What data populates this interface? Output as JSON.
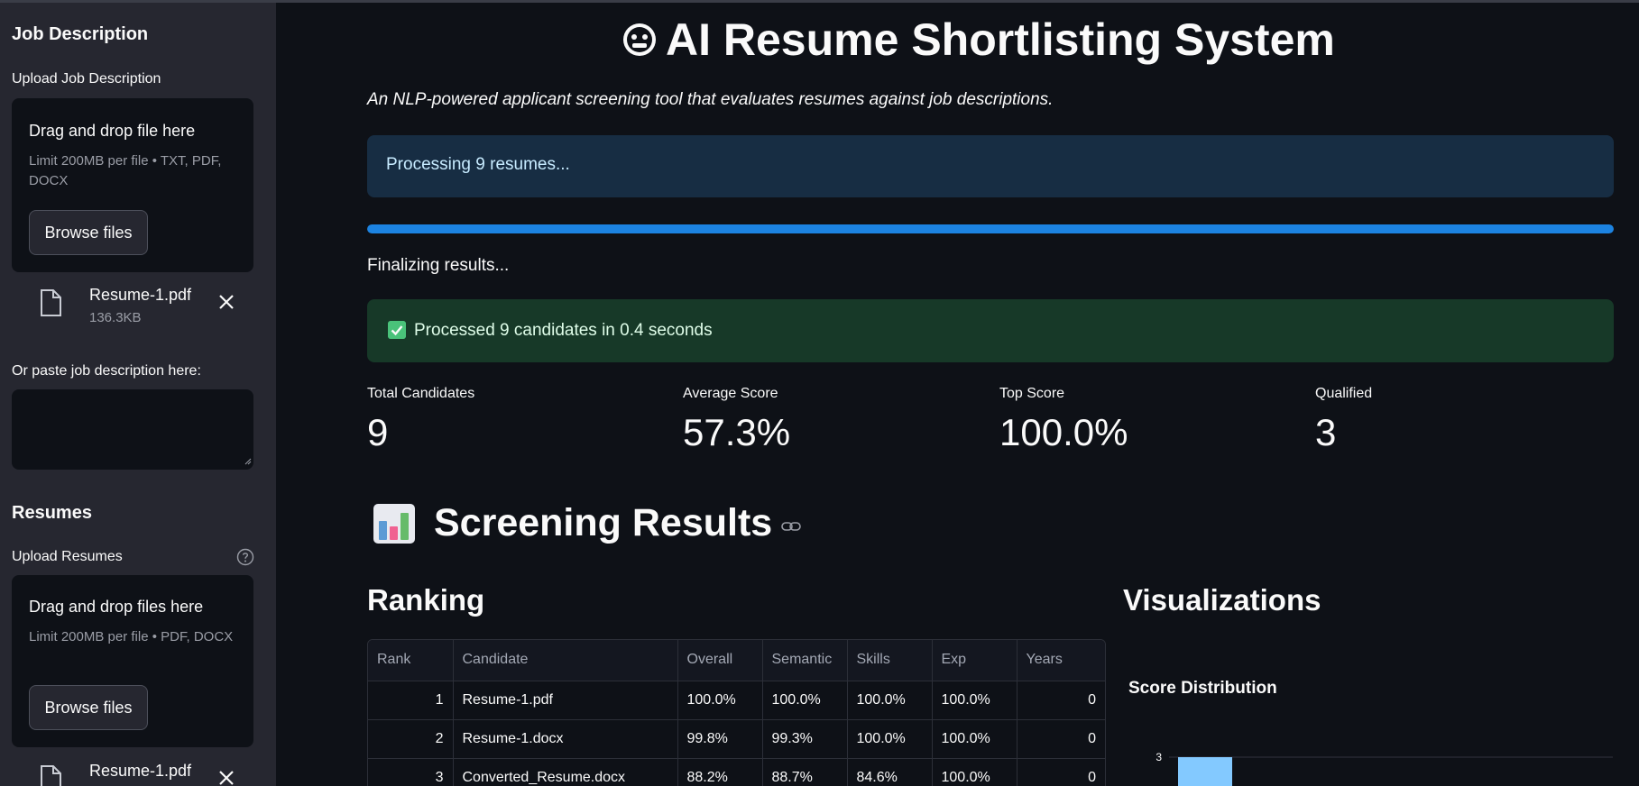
{
  "sidebar": {
    "job_heading": "Job Description",
    "job_upload_label": "Upload Job Description",
    "job_dropzone": {
      "title": "Drag and drop file here",
      "limit": "Limit 200MB per file • TXT, PDF, DOCX",
      "browse_label": "Browse files"
    },
    "job_file": {
      "name": "Resume-1.pdf",
      "size": "136.3KB"
    },
    "paste_label": "Or paste job description here:",
    "paste_value": "",
    "resumes_heading": "Resumes",
    "resumes_upload_label": "Upload Resumes",
    "resumes_dropzone": {
      "title": "Drag and drop files here",
      "limit": "Limit 200MB per file • PDF, DOCX",
      "browse_label": "Browse files"
    },
    "resume_file": {
      "name": "Resume-1.pdf"
    }
  },
  "main": {
    "title": "AI Resume Shortlisting System",
    "subtitle": "An NLP-powered applicant screening tool that evaluates resumes against job descriptions.",
    "info": "Processing 9 resumes...",
    "progress": 1.0,
    "progress_text": "Finalizing results...",
    "success": "Processed 9 candidates in 0.4 seconds",
    "metrics": [
      {
        "label": "Total Candidates",
        "value": "9"
      },
      {
        "label": "Average Score",
        "value": "57.3%"
      },
      {
        "label": "Top Score",
        "value": "100.0%"
      },
      {
        "label": "Qualified",
        "value": "3"
      }
    ],
    "section_title": "Screening Results",
    "ranking_heading": "Ranking",
    "visualizations_heading": "Visualizations",
    "table": {
      "headers": [
        "Rank",
        "Candidate",
        "Overall",
        "Semantic",
        "Skills",
        "Exp",
        "Years"
      ],
      "rows": [
        [
          "1",
          "Resume-1.pdf",
          "100.0%",
          "100.0%",
          "100.0%",
          "100.0%",
          "0"
        ],
        [
          "2",
          "Resume-1.docx",
          "99.8%",
          "99.3%",
          "100.0%",
          "100.0%",
          "0"
        ],
        [
          "3",
          "Converted_Resume.docx",
          "88.2%",
          "88.7%",
          "84.6%",
          "100.0%",
          "0"
        ]
      ]
    },
    "chart_title": "Score Distribution"
  },
  "chart_data": {
    "type": "bar",
    "title": "Score Distribution",
    "y_ticks": [
      "3"
    ],
    "values": [
      3
    ],
    "bar_color": "#83c9ff"
  },
  "colors": {
    "info_bg": "#172d43",
    "success_bg": "#173928",
    "progress": "#1c83e1",
    "sidebar_bg": "#262730",
    "page_bg": "#0e1117"
  }
}
